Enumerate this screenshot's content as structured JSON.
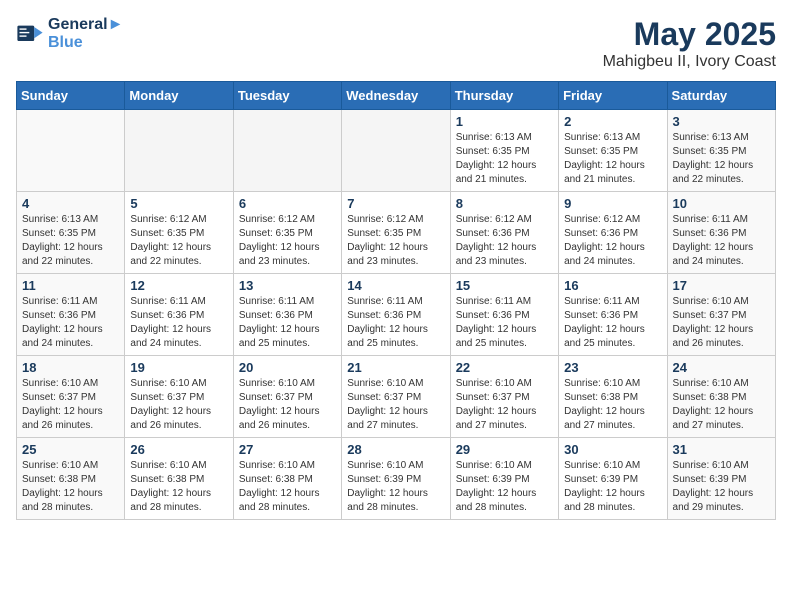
{
  "header": {
    "logo_line1": "General",
    "logo_line2": "Blue",
    "month": "May 2025",
    "location": "Mahigbeu II, Ivory Coast"
  },
  "weekdays": [
    "Sunday",
    "Monday",
    "Tuesday",
    "Wednesday",
    "Thursday",
    "Friday",
    "Saturday"
  ],
  "weeks": [
    [
      {
        "day": "",
        "info": ""
      },
      {
        "day": "",
        "info": ""
      },
      {
        "day": "",
        "info": ""
      },
      {
        "day": "",
        "info": ""
      },
      {
        "day": "1",
        "info": "Sunrise: 6:13 AM\nSunset: 6:35 PM\nDaylight: 12 hours\nand 21 minutes."
      },
      {
        "day": "2",
        "info": "Sunrise: 6:13 AM\nSunset: 6:35 PM\nDaylight: 12 hours\nand 21 minutes."
      },
      {
        "day": "3",
        "info": "Sunrise: 6:13 AM\nSunset: 6:35 PM\nDaylight: 12 hours\nand 22 minutes."
      }
    ],
    [
      {
        "day": "4",
        "info": "Sunrise: 6:13 AM\nSunset: 6:35 PM\nDaylight: 12 hours\nand 22 minutes."
      },
      {
        "day": "5",
        "info": "Sunrise: 6:12 AM\nSunset: 6:35 PM\nDaylight: 12 hours\nand 22 minutes."
      },
      {
        "day": "6",
        "info": "Sunrise: 6:12 AM\nSunset: 6:35 PM\nDaylight: 12 hours\nand 23 minutes."
      },
      {
        "day": "7",
        "info": "Sunrise: 6:12 AM\nSunset: 6:35 PM\nDaylight: 12 hours\nand 23 minutes."
      },
      {
        "day": "8",
        "info": "Sunrise: 6:12 AM\nSunset: 6:36 PM\nDaylight: 12 hours\nand 23 minutes."
      },
      {
        "day": "9",
        "info": "Sunrise: 6:12 AM\nSunset: 6:36 PM\nDaylight: 12 hours\nand 24 minutes."
      },
      {
        "day": "10",
        "info": "Sunrise: 6:11 AM\nSunset: 6:36 PM\nDaylight: 12 hours\nand 24 minutes."
      }
    ],
    [
      {
        "day": "11",
        "info": "Sunrise: 6:11 AM\nSunset: 6:36 PM\nDaylight: 12 hours\nand 24 minutes."
      },
      {
        "day": "12",
        "info": "Sunrise: 6:11 AM\nSunset: 6:36 PM\nDaylight: 12 hours\nand 24 minutes."
      },
      {
        "day": "13",
        "info": "Sunrise: 6:11 AM\nSunset: 6:36 PM\nDaylight: 12 hours\nand 25 minutes."
      },
      {
        "day": "14",
        "info": "Sunrise: 6:11 AM\nSunset: 6:36 PM\nDaylight: 12 hours\nand 25 minutes."
      },
      {
        "day": "15",
        "info": "Sunrise: 6:11 AM\nSunset: 6:36 PM\nDaylight: 12 hours\nand 25 minutes."
      },
      {
        "day": "16",
        "info": "Sunrise: 6:11 AM\nSunset: 6:36 PM\nDaylight: 12 hours\nand 25 minutes."
      },
      {
        "day": "17",
        "info": "Sunrise: 6:10 AM\nSunset: 6:37 PM\nDaylight: 12 hours\nand 26 minutes."
      }
    ],
    [
      {
        "day": "18",
        "info": "Sunrise: 6:10 AM\nSunset: 6:37 PM\nDaylight: 12 hours\nand 26 minutes."
      },
      {
        "day": "19",
        "info": "Sunrise: 6:10 AM\nSunset: 6:37 PM\nDaylight: 12 hours\nand 26 minutes."
      },
      {
        "day": "20",
        "info": "Sunrise: 6:10 AM\nSunset: 6:37 PM\nDaylight: 12 hours\nand 26 minutes."
      },
      {
        "day": "21",
        "info": "Sunrise: 6:10 AM\nSunset: 6:37 PM\nDaylight: 12 hours\nand 27 minutes."
      },
      {
        "day": "22",
        "info": "Sunrise: 6:10 AM\nSunset: 6:37 PM\nDaylight: 12 hours\nand 27 minutes."
      },
      {
        "day": "23",
        "info": "Sunrise: 6:10 AM\nSunset: 6:38 PM\nDaylight: 12 hours\nand 27 minutes."
      },
      {
        "day": "24",
        "info": "Sunrise: 6:10 AM\nSunset: 6:38 PM\nDaylight: 12 hours\nand 27 minutes."
      }
    ],
    [
      {
        "day": "25",
        "info": "Sunrise: 6:10 AM\nSunset: 6:38 PM\nDaylight: 12 hours\nand 28 minutes."
      },
      {
        "day": "26",
        "info": "Sunrise: 6:10 AM\nSunset: 6:38 PM\nDaylight: 12 hours\nand 28 minutes."
      },
      {
        "day": "27",
        "info": "Sunrise: 6:10 AM\nSunset: 6:38 PM\nDaylight: 12 hours\nand 28 minutes."
      },
      {
        "day": "28",
        "info": "Sunrise: 6:10 AM\nSunset: 6:39 PM\nDaylight: 12 hours\nand 28 minutes."
      },
      {
        "day": "29",
        "info": "Sunrise: 6:10 AM\nSunset: 6:39 PM\nDaylight: 12 hours\nand 28 minutes."
      },
      {
        "day": "30",
        "info": "Sunrise: 6:10 AM\nSunset: 6:39 PM\nDaylight: 12 hours\nand 28 minutes."
      },
      {
        "day": "31",
        "info": "Sunrise: 6:10 AM\nSunset: 6:39 PM\nDaylight: 12 hours\nand 29 minutes."
      }
    ]
  ]
}
